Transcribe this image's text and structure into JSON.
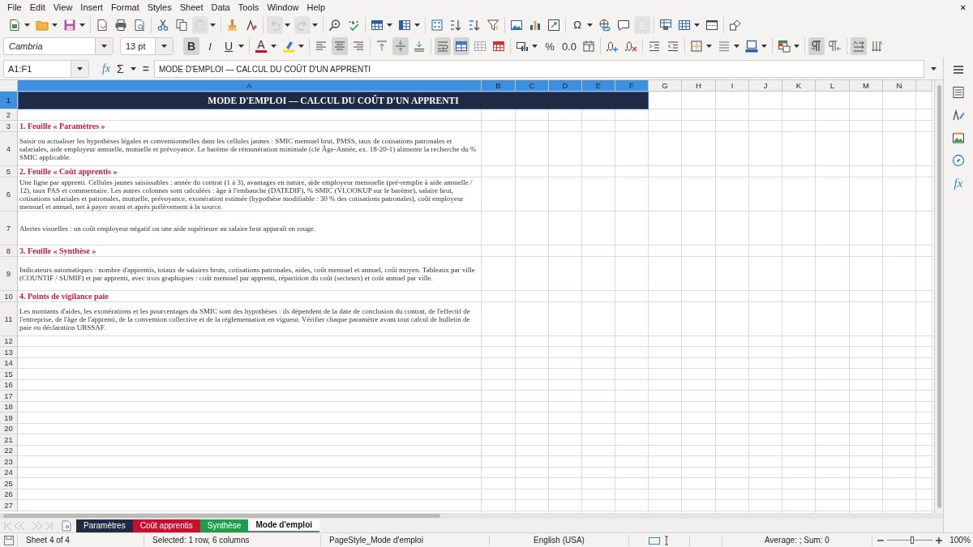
{
  "menu": {
    "items": [
      "File",
      "Edit",
      "View",
      "Insert",
      "Format",
      "Styles",
      "Sheet",
      "Data",
      "Tools",
      "Window",
      "Help"
    ],
    "close": "×"
  },
  "toolbar_standard": [
    [
      {
        "kind": "new",
        "dropdown": true,
        "disabled": false
      },
      {
        "kind": "open",
        "dropdown": true,
        "disabled": false
      },
      {
        "kind": "save",
        "dropdown": true,
        "disabled": false
      }
    ],
    [
      {
        "kind": "pdf",
        "dropdown": false,
        "disabled": false
      },
      {
        "kind": "print",
        "dropdown": false,
        "disabled": false
      },
      {
        "kind": "preview",
        "dropdown": false,
        "disabled": false
      }
    ],
    [
      {
        "kind": "cut",
        "dropdown": false,
        "disabled": false
      },
      {
        "kind": "copy",
        "dropdown": false,
        "disabled": false
      },
      {
        "kind": "paste",
        "dropdown": true,
        "disabled": true
      }
    ],
    [
      {
        "kind": "clone",
        "dropdown": false,
        "disabled": false
      },
      {
        "kind": "clear",
        "dropdown": false,
        "disabled": false
      }
    ],
    [
      {
        "kind": "undo",
        "dropdown": true,
        "disabled": true
      },
      {
        "kind": "redo",
        "dropdown": true,
        "disabled": true
      }
    ],
    [
      {
        "kind": "find",
        "dropdown": false,
        "disabled": false
      },
      {
        "kind": "spell",
        "dropdown": false,
        "disabled": false
      }
    ],
    [
      {
        "kind": "rows",
        "dropdown": true,
        "disabled": false
      },
      {
        "kind": "columns",
        "dropdown": true,
        "disabled": false
      }
    ],
    [
      {
        "kind": "sort",
        "dropdown": false,
        "disabled": false
      },
      {
        "kind": "sortasc",
        "dropdown": false,
        "disabled": false
      },
      {
        "kind": "sortdesc",
        "dropdown": false,
        "disabled": false
      },
      {
        "kind": "filter",
        "dropdown": false,
        "disabled": false
      }
    ],
    [
      {
        "kind": "image",
        "dropdown": false,
        "disabled": false
      },
      {
        "kind": "chart",
        "dropdown": false,
        "disabled": false
      },
      {
        "kind": "pivot",
        "dropdown": false,
        "disabled": false
      }
    ],
    [
      {
        "kind": "glyph",
        "label": "Ω",
        "dropdown": true,
        "disabled": false
      },
      {
        "kind": "link",
        "dropdown": false,
        "disabled": false
      },
      {
        "kind": "comment",
        "dropdown": false,
        "disabled": false
      },
      {
        "kind": "header",
        "dropdown": false,
        "disabled": true
      }
    ],
    [
      {
        "kind": "printarea",
        "dropdown": false,
        "disabled": false
      },
      {
        "kind": "freeze",
        "dropdown": true,
        "disabled": false
      },
      {
        "kind": "split",
        "dropdown": false,
        "disabled": false
      }
    ],
    [
      {
        "kind": "shapes",
        "dropdown": false,
        "disabled": false
      }
    ]
  ],
  "font_name": "Cambria",
  "font_size": "13 pt",
  "toolbar_formatting": [
    [
      {
        "kind": "bold",
        "label": "B",
        "dropdown": false,
        "selected": true
      },
      {
        "kind": "italic",
        "label": "I",
        "dropdown": false,
        "selected": false
      },
      {
        "kind": "underline",
        "label": "U",
        "dropdown": true,
        "selected": false
      }
    ],
    [
      {
        "kind": "fontcolor",
        "label": "A",
        "dropdown": true,
        "selected": false
      },
      {
        "kind": "highlight",
        "dropdown": true,
        "selected": false
      }
    ],
    [
      {
        "kind": "alignleft",
        "dropdown": false,
        "selected": false
      },
      {
        "kind": "aligncenter",
        "dropdown": false,
        "selected": true
      },
      {
        "kind": "alignright",
        "dropdown": false,
        "selected": false
      }
    ],
    [
      {
        "kind": "aligntop",
        "dropdown": false,
        "selected": false
      },
      {
        "kind": "alignmiddle",
        "dropdown": false,
        "selected": true
      },
      {
        "kind": "alignbottom",
        "dropdown": false,
        "selected": false
      }
    ],
    [
      {
        "kind": "wrap",
        "dropdown": false,
        "selected": true
      },
      {
        "kind": "mergecenter",
        "dropdown": false,
        "selected": true
      },
      {
        "kind": "merge",
        "dropdown": false,
        "selected": false
      },
      {
        "kind": "unmerge",
        "dropdown": false,
        "selected": false
      }
    ],
    [
      {
        "kind": "currency",
        "dropdown": true,
        "selected": false
      },
      {
        "kind": "glyph",
        "label": "%",
        "dropdown": false,
        "selected": false
      },
      {
        "kind": "glyph",
        "label": "0.0",
        "dropdown": false,
        "selected": false
      },
      {
        "kind": "date",
        "dropdown": false,
        "selected": false
      }
    ],
    [
      {
        "kind": "adddecimal",
        "dropdown": false,
        "selected": false
      },
      {
        "kind": "deldecimal",
        "dropdown": false,
        "selected": false
      }
    ],
    [
      {
        "kind": "indent",
        "dropdown": false,
        "selected": false
      },
      {
        "kind": "outdent",
        "dropdown": false,
        "selected": false
      }
    ],
    [
      {
        "kind": "borders",
        "dropdown": true,
        "selected": false
      },
      {
        "kind": "borderstyle",
        "dropdown": true,
        "selected": false
      },
      {
        "kind": "bordercolor",
        "dropdown": true,
        "selected": false
      }
    ],
    [
      {
        "kind": "conditional",
        "dropdown": true,
        "selected": false
      }
    ],
    [
      {
        "kind": "ltr",
        "dropdown": false,
        "selected": true
      },
      {
        "kind": "rtl",
        "dropdown": false,
        "selected": false
      }
    ],
    [
      {
        "kind": "textdir",
        "dropdown": false,
        "selected": true
      },
      {
        "kind": "vertical",
        "dropdown": false,
        "selected": false
      }
    ]
  ],
  "formula_bar": {
    "name_box": "A1:F1",
    "buttons": [
      {
        "label": "fx",
        "dropdown": false
      },
      {
        "label": "Σ",
        "dropdown": true
      },
      {
        "label": "=",
        "dropdown": false
      }
    ],
    "content": "MODE D'EMPLOI — CALCUL DU COÛT D'UN APPRENTI"
  },
  "sidebar": [
    {
      "kind": "menu"
    },
    {
      "kind": "properties"
    },
    {
      "kind": "styles"
    },
    {
      "kind": "gallery"
    },
    {
      "kind": "navigator"
    },
    {
      "kind": "glyph",
      "label": "fx"
    }
  ],
  "sheet": {
    "columns": [
      {
        "label": "A",
        "selected": true
      },
      {
        "label": "B",
        "selected": true
      },
      {
        "label": "C",
        "selected": true
      },
      {
        "label": "D",
        "selected": true
      },
      {
        "label": "E",
        "selected": true
      },
      {
        "label": "F",
        "selected": true
      },
      {
        "label": "G",
        "selected": false
      },
      {
        "label": "H",
        "selected": false
      },
      {
        "label": "I",
        "selected": false
      },
      {
        "label": "J",
        "selected": false
      },
      {
        "label": "K",
        "selected": false
      },
      {
        "label": "L",
        "selected": false
      },
      {
        "label": "M",
        "selected": false
      },
      {
        "label": "N",
        "selected": false
      }
    ],
    "rows": [
      {
        "label": "1",
        "selected": true,
        "kind": "title",
        "text": "MODE D'EMPLOI — CALCUL DU COÛT D'UN APPRENTI"
      },
      {
        "label": "2",
        "selected": false,
        "kind": "empty"
      },
      {
        "label": "3",
        "selected": false,
        "kind": "heading",
        "text": "1. Feuille « Paramètres »"
      },
      {
        "label": "4",
        "selected": false,
        "kind": "body",
        "text": "Saisir ou actualiser les hypothèses légales et conventionnelles dans les cellules jaunes : SMIC mensuel brut, PMSS, taux de cotisations patronales et salariales, aide employeur annuelle, mutuelle et prévoyance. Le barème de rémunération minimale (clé Âge-Année, ex. 18-20-1) alimente la recherche du % SMIC applicable."
      },
      {
        "label": "5",
        "selected": false,
        "kind": "heading",
        "text": "2. Feuille « Coût apprentis »"
      },
      {
        "label": "6",
        "selected": false,
        "kind": "body",
        "text": "Une ligne par apprenti. Cellules jaunes saisissables : année du contrat (1 à 3), avantages en nature, aide employeur mensuelle (pré-remplie à aide annuelle / 12), taux PAS et commentaire. Les autres colonnes sont calculées : âge à l'embauche (DATEDIF), % SMIC (VLOOKUP sur le barème), salaire brut, cotisations salariales et patronales, mutuelle, prévoyance, exonération estimée (hypothèse modifiable : 30 % des cotisations patronales), coût employeur mensuel et annuel, net à payer avant et après prélèvement à la source."
      },
      {
        "label": "7",
        "selected": false,
        "kind": "body",
        "text": "Alertes visuelles : un coût employeur négatif ou une aide supérieure au salaire brut apparaît en rouge."
      },
      {
        "label": "8",
        "selected": false,
        "kind": "heading",
        "text": "3. Feuille « Synthèse »"
      },
      {
        "label": "9",
        "selected": false,
        "kind": "body",
        "text": "Indicateurs automatiques : nombre d'apprentis, totaux de salaires bruts, cotisations patronales, aides, coût mensuel et annuel, coût moyen. Tableaux par ville (COUNTIF / SUMIF) et par apprenti, avec trois graphiques : coût mensuel par apprenti, répartition du coût (secteurs) et coût annuel par ville."
      },
      {
        "label": "10",
        "selected": false,
        "kind": "heading",
        "text": "4. Points de vigilance paie"
      },
      {
        "label": "11",
        "selected": false,
        "kind": "body",
        "text": "Les montants d'aides, les exonérations et les pourcentages du SMIC sont des hypothèses : ils dépendent de la date de conclusion du contrat, de l'effectif de l'entreprise, de l'âge de l'apprenti, de la convention collective et de la réglementation en vigueur. Vérifier chaque paramètre avant tout calcul de bulletin de paie ou déclaration URSSAF."
      },
      {
        "label": "12",
        "selected": false,
        "kind": "empty"
      },
      {
        "label": "13",
        "selected": false,
        "kind": "empty"
      },
      {
        "label": "14",
        "selected": false,
        "kind": "empty"
      },
      {
        "label": "15",
        "selected": false,
        "kind": "empty"
      },
      {
        "label": "16",
        "selected": false,
        "kind": "empty"
      },
      {
        "label": "17",
        "selected": false,
        "kind": "empty"
      },
      {
        "label": "18",
        "selected": false,
        "kind": "empty"
      },
      {
        "label": "19",
        "selected": false,
        "kind": "empty"
      },
      {
        "label": "20",
        "selected": false,
        "kind": "empty"
      },
      {
        "label": "21",
        "selected": false,
        "kind": "empty"
      },
      {
        "label": "22",
        "selected": false,
        "kind": "empty"
      },
      {
        "label": "23",
        "selected": false,
        "kind": "empty"
      },
      {
        "label": "24",
        "selected": false,
        "kind": "empty"
      },
      {
        "label": "25",
        "selected": false,
        "kind": "empty"
      },
      {
        "label": "26",
        "selected": false,
        "kind": "empty"
      },
      {
        "label": "27",
        "selected": false,
        "kind": "empty"
      }
    ]
  },
  "sheet_tabs": [
    {
      "label": "Paramètres",
      "color": "#1f2a44",
      "selected": false
    },
    {
      "label": "Coût apprentis",
      "color": "#c8102e",
      "selected": false
    },
    {
      "label": "Synthèse",
      "color": "#1e9e4a",
      "selected": false
    },
    {
      "label": "Mode d'emploi",
      "selected": true
    }
  ],
  "status_bar": {
    "sheet": "Sheet 4 of 4",
    "selection": "Selected: 1 row, 6 columns",
    "page_style": "PageStyle_Mode d'emploi",
    "language": "English (USA)",
    "summary": "Average: ; Sum: 0",
    "zoom": {
      "level": 0.55
    },
    "zoom_percent": "100%"
  }
}
